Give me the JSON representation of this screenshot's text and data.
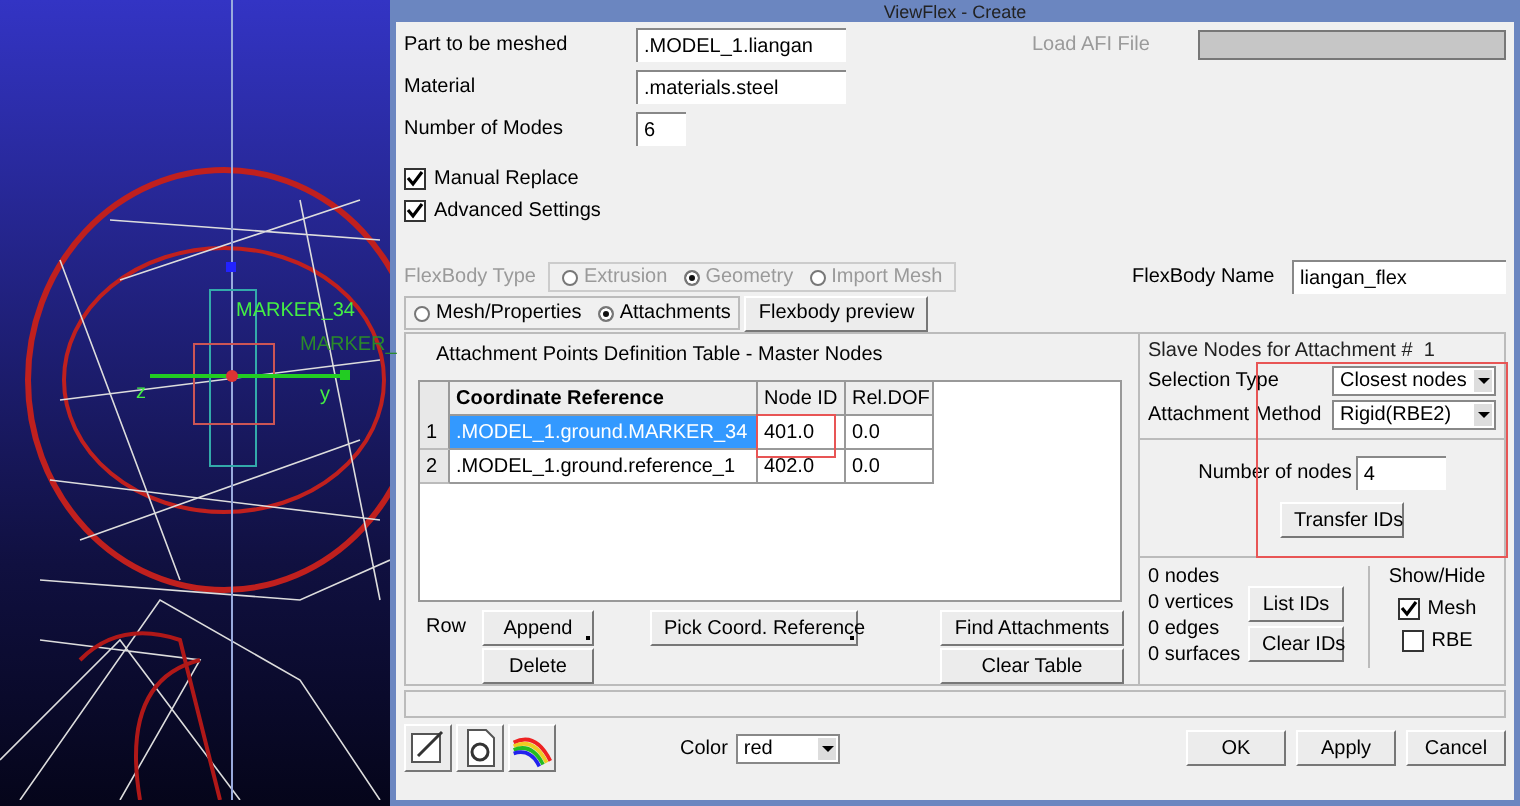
{
  "window": {
    "title": "ViewFlex - Create"
  },
  "viewport": {
    "labels": [
      {
        "text": "MARKER_34",
        "kind": "marker"
      },
      {
        "text": "MARKER_",
        "kind": "faint"
      },
      {
        "text": "z",
        "kind": "axis"
      },
      {
        "text": "y",
        "kind": "axis"
      }
    ]
  },
  "form": {
    "fields": [
      {
        "label": "Part to be meshed",
        "value": ".MODEL_1.liangan"
      },
      {
        "label": "Material",
        "value": ".materials.steel"
      },
      {
        "label": "Number of Modes",
        "value": "6"
      }
    ],
    "load_afi": {
      "label": "Load AFI File",
      "disabled": true
    },
    "checkboxes": [
      {
        "label": "Manual Replace",
        "checked": true
      },
      {
        "label": "Advanced Settings",
        "checked": true
      }
    ]
  },
  "flexbody_type": {
    "label": "FlexBody Type",
    "disabled": true,
    "options": [
      {
        "label": "Extrusion",
        "selected": false
      },
      {
        "label": "Geometry",
        "selected": true
      },
      {
        "label": "Import Mesh",
        "selected": false
      }
    ]
  },
  "flexbody_name": {
    "label": "FlexBody Name",
    "value": "liangan_flex"
  },
  "tabs": [
    {
      "label": "Mesh/Properties",
      "selected": false
    },
    {
      "label": "Attachments",
      "selected": true
    }
  ],
  "preview_button": "Flexbody preview",
  "table": {
    "title": "Attachment Points Definition Table - Master Nodes",
    "columns": [
      "Coordinate Reference",
      "Node ID",
      "Rel.DOF"
    ],
    "rows": [
      {
        "index": "1",
        "cells": [
          ".MODEL_1.ground.MARKER_34",
          "401.0",
          "0.0"
        ],
        "selected": true
      },
      {
        "index": "2",
        "cells": [
          ".MODEL_1.ground.reference_1",
          "402.0",
          "0.0"
        ],
        "selected": false
      }
    ]
  },
  "row_controls": {
    "label": "Row",
    "buttons": [
      {
        "label": "Append",
        "has_menu": true
      },
      {
        "label": "Delete",
        "has_menu": false
      }
    ],
    "pick_button": {
      "label": "Pick Coord. Reference",
      "has_menu": true
    },
    "find_button": "Find Attachments",
    "clear_button": "Clear Table"
  },
  "slave_nodes": {
    "title": "Slave Nodes for Attachment #  1",
    "selection_type": {
      "label": "Selection Type",
      "value": "Closest nodes"
    },
    "attachment_method": {
      "label": "Attachment Method",
      "value": "Rigid(RBE2)"
    },
    "number_of_nodes": {
      "label": "Number of nodes",
      "value": "4"
    },
    "transfer_button": "Transfer IDs"
  },
  "counts": [
    "0 nodes",
    "0 vertices",
    "0 edges",
    "0 surfaces"
  ],
  "id_buttons": [
    "List IDs",
    "Clear IDs"
  ],
  "show_hide": {
    "title": "Show/Hide",
    "options": [
      {
        "label": "Mesh",
        "checked": true
      },
      {
        "label": "RBE",
        "checked": false
      }
    ]
  },
  "color": {
    "label": "Color",
    "value": "red"
  },
  "buttons": [
    "OK",
    "Apply",
    "Cancel"
  ]
}
